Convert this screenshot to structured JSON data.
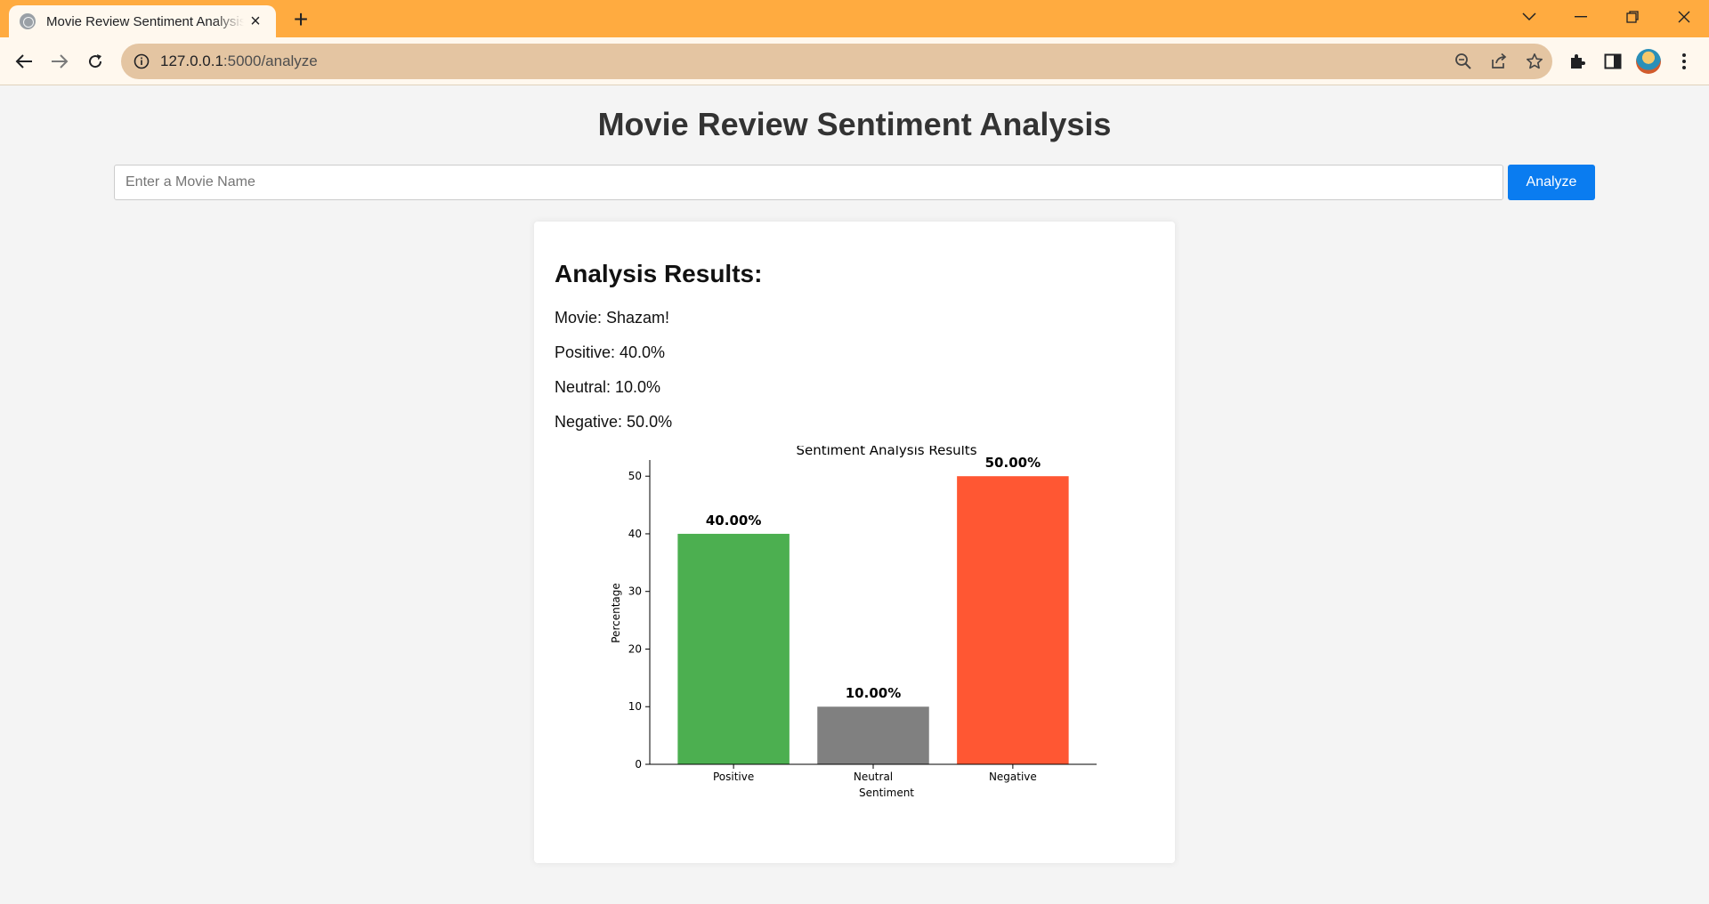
{
  "browser": {
    "tab_title": "Movie Review Sentiment Analysis",
    "url_host": "127.0.0.1",
    "url_path": ":5000/analyze"
  },
  "page": {
    "title": "Movie Review Sentiment Analysis",
    "search": {
      "placeholder": "Enter a Movie Name",
      "value": ""
    },
    "analyze_label": "Analyze",
    "accent_color": "#0a7cf0"
  },
  "results": {
    "heading": "Analysis Results:",
    "movie_line": "Movie: Shazam!",
    "positive_line": "Positive: 40.0%",
    "neutral_line": "Neutral: 10.0%",
    "negative_line": "Negative: 50.0%"
  },
  "chart_data": {
    "type": "bar",
    "title": "Sentiment Analysis Results",
    "xlabel": "Sentiment",
    "ylabel": "Percentage",
    "categories": [
      "Positive",
      "Neutral",
      "Negative"
    ],
    "values": [
      40,
      10,
      50
    ],
    "data_labels": [
      "40.00%",
      "10.00%",
      "50.00%"
    ],
    "colors": [
      "#4caf50",
      "#808080",
      "#ff5733"
    ],
    "ylim": [
      0,
      52.5
    ],
    "yticks": [
      0,
      10,
      20,
      30,
      40,
      50
    ],
    "grid": false
  }
}
